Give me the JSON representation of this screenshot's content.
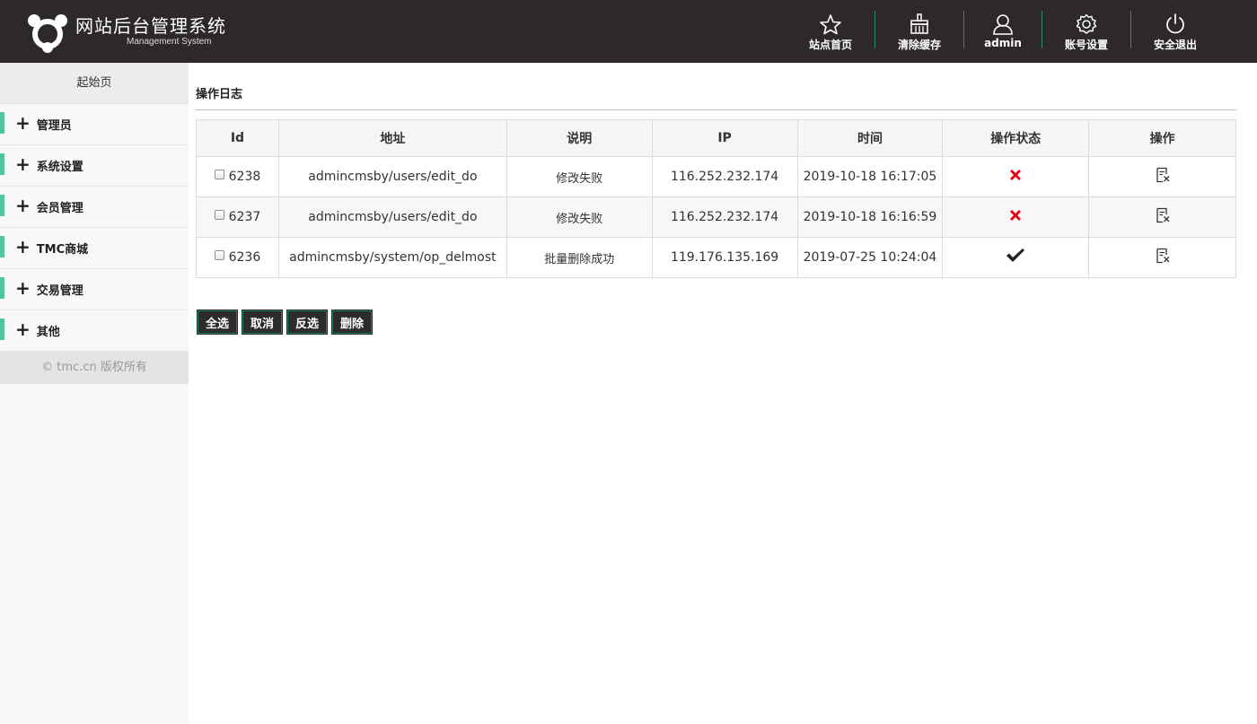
{
  "header": {
    "title": "网站后台管理系统",
    "subtitle": "Management System",
    "nav": [
      {
        "label": "站点首页",
        "icon": "star-icon"
      },
      {
        "label": "清除缓存",
        "icon": "broom-icon"
      },
      {
        "label": "admin",
        "icon": "user-icon"
      },
      {
        "label": "账号设置",
        "icon": "gear-icon"
      },
      {
        "label": "安全退出",
        "icon": "power-icon"
      }
    ]
  },
  "sidebar": {
    "home": "起始页",
    "items": [
      {
        "label": "管理员"
      },
      {
        "label": "系统设置"
      },
      {
        "label": "会员管理"
      },
      {
        "label": "TMC商城"
      },
      {
        "label": "交易管理"
      },
      {
        "label": "其他"
      }
    ],
    "footer": "© tmc.cn 版权所有"
  },
  "main": {
    "title": "操作日志",
    "columns": [
      "Id",
      "地址",
      "说明",
      "IP",
      "时间",
      "操作状态",
      "操作"
    ],
    "rows": [
      {
        "id": "6238",
        "address": "admincmsby/users/edit_do",
        "desc": "修改失败",
        "ip": "116.252.232.174",
        "time": "2019-10-18 16:17:05",
        "status": "fail"
      },
      {
        "id": "6237",
        "address": "admincmsby/users/edit_do",
        "desc": "修改失败",
        "ip": "116.252.232.174",
        "time": "2019-10-18 16:16:59",
        "status": "fail"
      },
      {
        "id": "6236",
        "address": "admincmsby/system/op_delmost",
        "desc": "批量删除成功",
        "ip": "119.176.135.169",
        "time": "2019-07-25 10:24:04",
        "status": "success"
      }
    ],
    "buttons": {
      "select_all": "全选",
      "cancel": "取消",
      "invert": "反选",
      "delete": "删除"
    }
  },
  "colors": {
    "header_bg": "#2c282b",
    "accent": "#4ec79a",
    "fail": "#e60012",
    "success": "#222222"
  }
}
